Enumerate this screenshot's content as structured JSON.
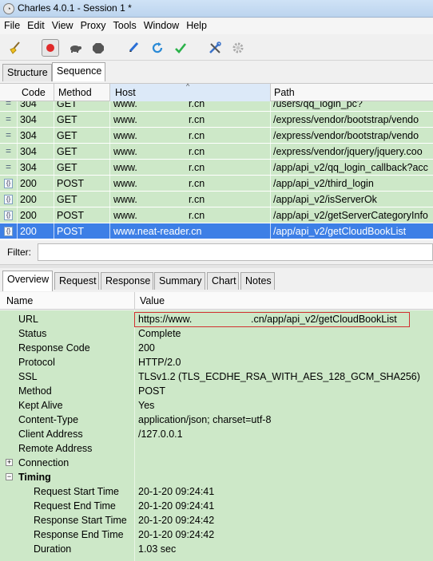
{
  "window": {
    "title": "Charles 4.0.1 - Session 1 *"
  },
  "menu": [
    "File",
    "Edit",
    "View",
    "Proxy",
    "Tools",
    "Window",
    "Help"
  ],
  "toolbar": {
    "icons": [
      "broom-icon",
      "record-icon",
      "throttle-turtle-icon",
      "breakpoint-hexagon-icon",
      "pen-edit-icon",
      "refresh-icon",
      "checkmark-icon",
      "tools-icon",
      "settings-gear-icon"
    ]
  },
  "top_tabs": [
    "Structure",
    "Sequence"
  ],
  "sequence": {
    "columns": [
      "Code",
      "Method",
      "Host",
      "Path"
    ],
    "rows": [
      {
        "code": "304",
        "method": "GET",
        "host": "www.",
        "host_tail": "r.cn",
        "path": "/users/qq_login_pc?"
      },
      {
        "code": "304",
        "method": "GET",
        "host": "www.",
        "host_tail": "r.cn",
        "path": "/express/vendor/bootstrap/vendo"
      },
      {
        "code": "304",
        "method": "GET",
        "host": "www.",
        "host_tail": "r.cn",
        "path": "/express/vendor/bootstrap/vendo"
      },
      {
        "code": "304",
        "method": "GET",
        "host": "www.",
        "host_tail": "r.cn",
        "path": "/express/vendor/jquery/jquery.coo"
      },
      {
        "code": "304",
        "method": "GET",
        "host": "www.",
        "host_tail": "r.cn",
        "path": "/app/api_v2/qq_login_callback?acc"
      },
      {
        "code": "200",
        "method": "POST",
        "host": "www.",
        "host_tail": "r.cn",
        "path": "/app/api_v2/third_login"
      },
      {
        "code": "200",
        "method": "GET",
        "host": "www.",
        "host_tail": "r.cn",
        "path": "/app/api_v2/isServerOk"
      },
      {
        "code": "200",
        "method": "POST",
        "host": "www.",
        "host_tail": "r.cn",
        "path": "/app/api_v2/getServerCategoryInfo"
      },
      {
        "code": "200",
        "method": "POST",
        "host": "www.neat-reader.cn",
        "host_tail": "",
        "path": "/app/api_v2/getCloudBookList"
      }
    ]
  },
  "filter": {
    "label": "Filter:",
    "value": ""
  },
  "bottom_tabs": [
    "Overview",
    "Request",
    "Response",
    "Summary",
    "Chart",
    "Notes"
  ],
  "overview": {
    "columns": [
      "Name",
      "Value"
    ],
    "url": {
      "name": "URL",
      "value_prefix": "https://www.",
      "value_suffix": ".cn/app/api_v2/getCloudBookList"
    },
    "fields": [
      {
        "name": "Status",
        "value": "Complete"
      },
      {
        "name": "Response Code",
        "value": "200"
      },
      {
        "name": "Protocol",
        "value": "HTTP/2.0"
      },
      {
        "name": "SSL",
        "value": "TLSv1.2 (TLS_ECDHE_RSA_WITH_AES_128_GCM_SHA256)"
      },
      {
        "name": "Method",
        "value": "POST"
      },
      {
        "name": "Kept Alive",
        "value": "Yes"
      },
      {
        "name": "Content-Type",
        "value": "application/json; charset=utf-8"
      },
      {
        "name": "Client Address",
        "value": "/127.0.0.1"
      },
      {
        "name": "Remote Address",
        "value": ""
      }
    ],
    "connection": {
      "name": "Connection",
      "expander": "+"
    },
    "timing": {
      "name": "Timing",
      "expander": "−",
      "rows": [
        {
          "name": "Request Start Time",
          "value": "20-1-20 09:24:41"
        },
        {
          "name": "Request End Time",
          "value": "20-1-20 09:24:41"
        },
        {
          "name": "Response Start Time",
          "value": "20-1-20 09:24:42"
        },
        {
          "name": "Response End Time",
          "value": "20-1-20 09:24:42"
        },
        {
          "name": "Duration",
          "value": "1.03 sec"
        }
      ]
    }
  },
  "colors": {
    "row_bg": "#cde8c8",
    "selected_bg": "#3d7fe6",
    "url_highlight_border": "#d23030"
  }
}
